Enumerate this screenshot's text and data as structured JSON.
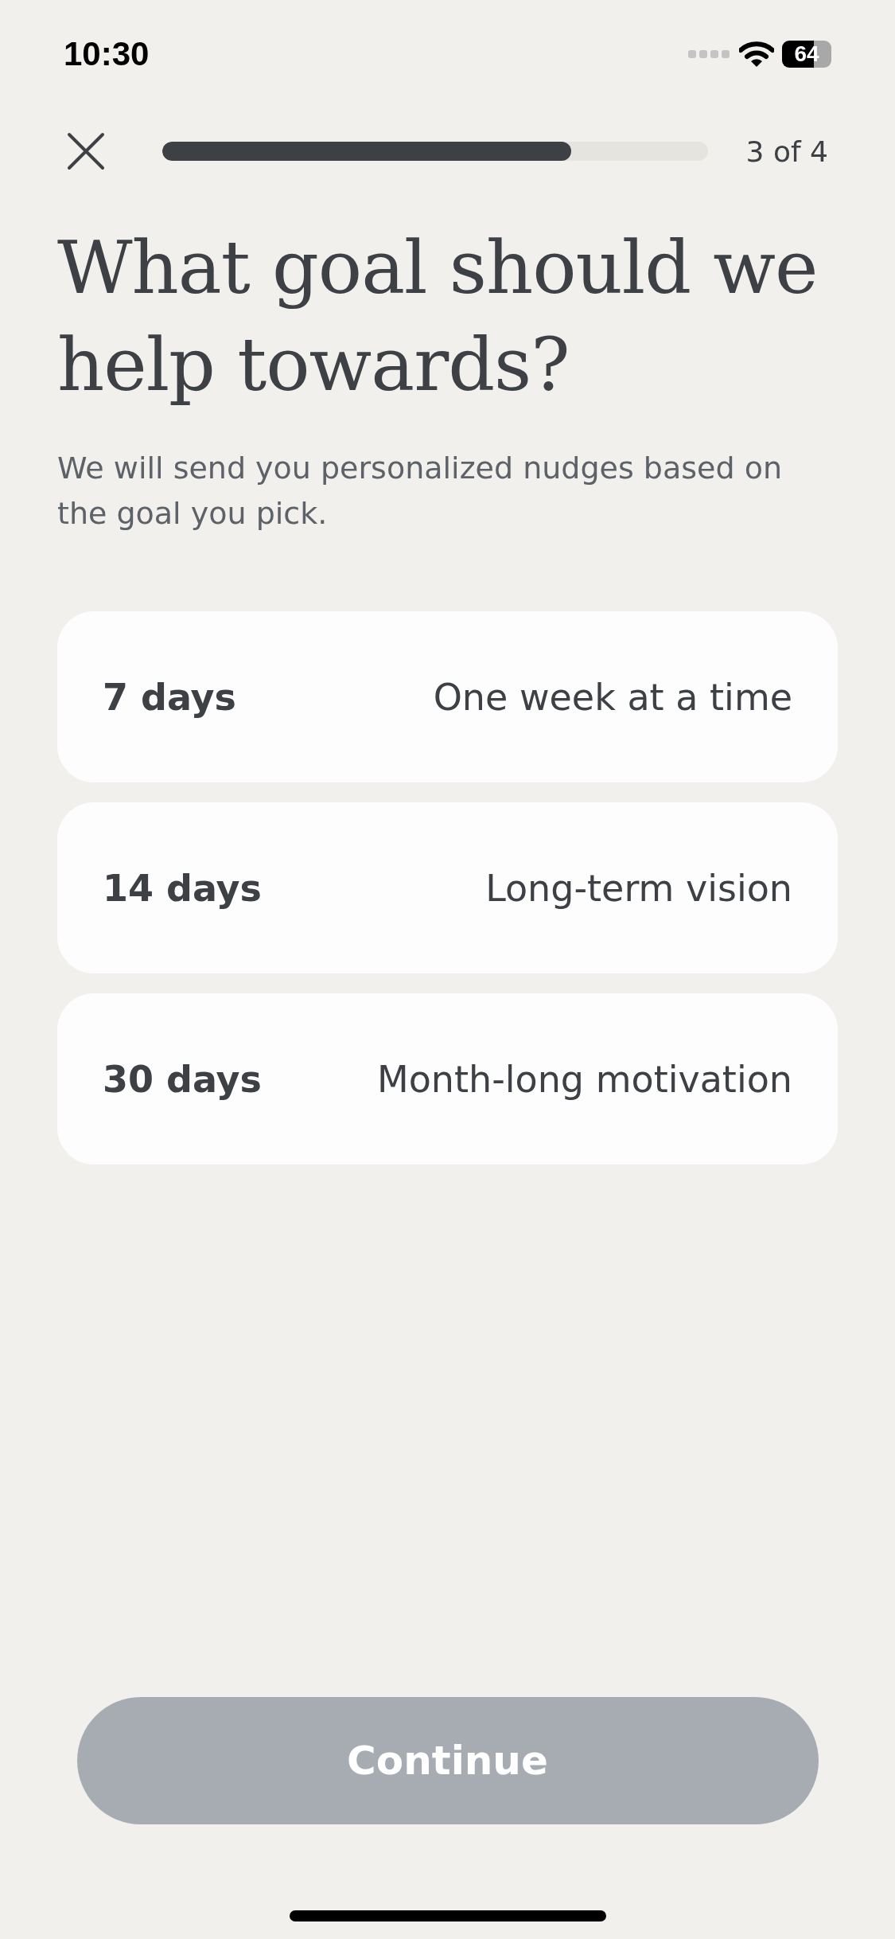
{
  "status_bar": {
    "time": "10:30",
    "battery": "64"
  },
  "header": {
    "progress": {
      "level": 0.75
    },
    "step": "3 of 4"
  },
  "title": "What goal should we help towards?",
  "subtitle": "We will send you personalized nudges based on the goal you pick.",
  "options": [
    {
      "duration": "7 days",
      "description": "One week at a time",
      "selected": false
    },
    {
      "duration": "14 days",
      "description": "Long-term vision",
      "selected": false
    },
    {
      "duration": "30 days",
      "description": "Month-long motivation",
      "selected": false
    }
  ],
  "continue_button": {
    "label": "Continue",
    "disabled": true
  }
}
